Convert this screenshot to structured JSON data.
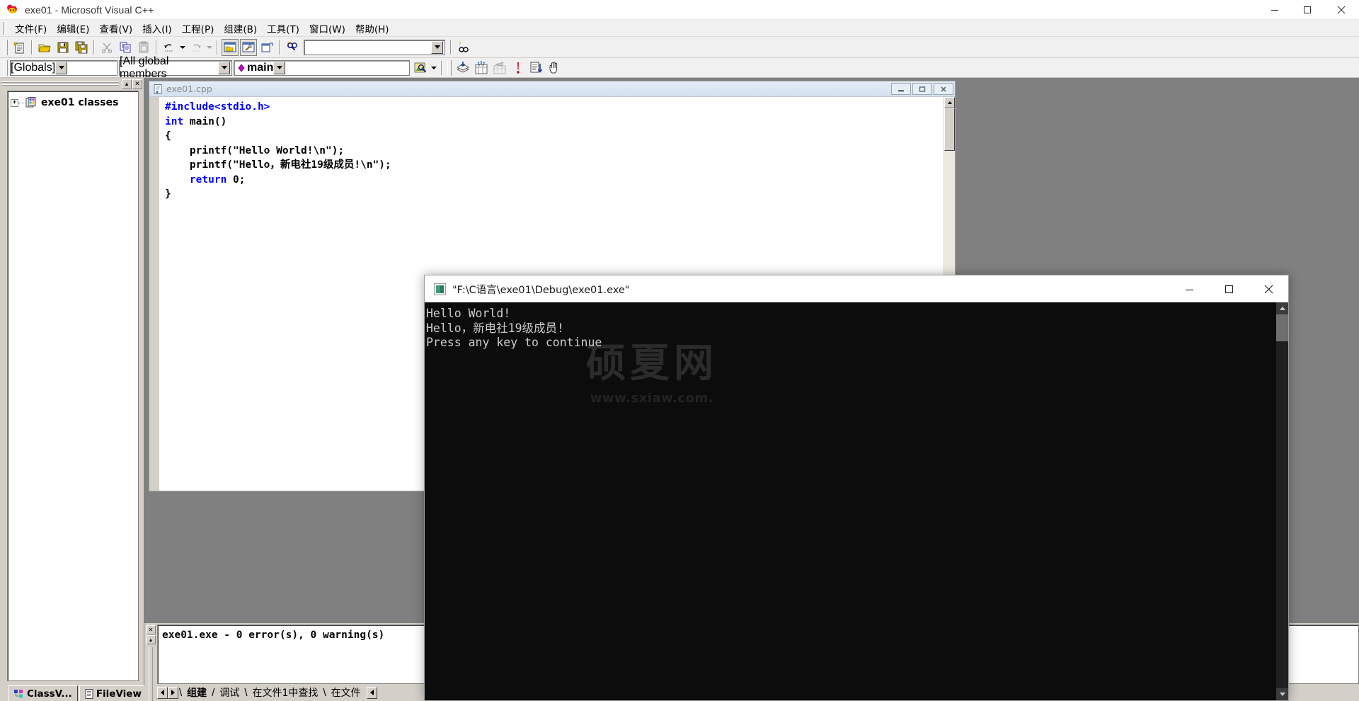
{
  "app": {
    "title": "exe01 - Microsoft Visual C++",
    "icon": "vcpp-logo-icon",
    "window_buttons": [
      {
        "name": "minimize",
        "glyph": "—"
      },
      {
        "name": "maximize",
        "glyph": "❐"
      },
      {
        "name": "close",
        "glyph": "✕"
      }
    ]
  },
  "menubar": {
    "items": [
      {
        "label": "文件(F)",
        "name": "menu-file"
      },
      {
        "label": "编辑(E)",
        "name": "menu-edit"
      },
      {
        "label": "查看(V)",
        "name": "menu-view"
      },
      {
        "label": "插入(I)",
        "name": "menu-insert"
      },
      {
        "label": "工程(P)",
        "name": "menu-project"
      },
      {
        "label": "组建(B)",
        "name": "menu-build"
      },
      {
        "label": "工具(T)",
        "name": "menu-tools"
      },
      {
        "label": "窗口(W)",
        "name": "menu-window"
      },
      {
        "label": "帮助(H)",
        "name": "menu-help"
      }
    ]
  },
  "toolbar": {
    "find_combo_value": "",
    "find_combo_placeholder": ""
  },
  "wizardbar": {
    "class_combo": "[Globals]",
    "members_combo": "[All global members",
    "function_combo": "main"
  },
  "workspace": {
    "tree": {
      "expander": "+",
      "root_label": "exe01 classes",
      "root_icon": "classes-folder-icon"
    },
    "tabs": [
      {
        "label": "ClassV...",
        "name": "tab-classview",
        "icon": "classview-icon",
        "active": true
      },
      {
        "label": "FileView",
        "name": "tab-fileview",
        "icon": "fileview-icon",
        "active": false
      }
    ],
    "buttons": [
      {
        "name": "ws-float-button",
        "glyph": "▴"
      },
      {
        "name": "ws-close-button",
        "glyph": "✕"
      }
    ]
  },
  "editor": {
    "tab_title": "exe01.cpp",
    "tab_icon": "cpp-file-icon",
    "mdi_buttons": [
      {
        "name": "mdi-minimize",
        "glyph": "–"
      },
      {
        "name": "mdi-restore",
        "glyph": "□"
      },
      {
        "name": "mdi-close",
        "glyph": "✕"
      }
    ],
    "code_lines": [
      {
        "tokens": [
          {
            "t": "#include<stdio.h>",
            "c": "kw"
          }
        ]
      },
      {
        "tokens": [
          {
            "t": "int",
            "c": "kw"
          },
          {
            "t": " main()",
            "c": "plain"
          }
        ]
      },
      {
        "tokens": [
          {
            "t": "{",
            "c": "plain"
          }
        ]
      },
      {
        "tokens": [
          {
            "t": "    printf(\"Hello World!\\n\");",
            "c": "plain"
          }
        ]
      },
      {
        "tokens": [
          {
            "t": "    printf(\"Hello，新电社19级成员!\\n\");",
            "c": "plain"
          }
        ]
      },
      {
        "tokens": [
          {
            "t": "    ",
            "c": "plain"
          },
          {
            "t": "return",
            "c": "kw"
          },
          {
            "t": " 0;",
            "c": "plain"
          }
        ]
      },
      {
        "tokens": [
          {
            "t": "}",
            "c": "plain"
          }
        ]
      }
    ]
  },
  "output": {
    "text": "exe01.exe - 0 error(s), 0 warning(s)",
    "tabs": [
      {
        "label": "组建",
        "name": "output-tab-build",
        "active": true
      },
      {
        "label": "调试",
        "name": "output-tab-debug",
        "active": false
      },
      {
        "label": "在文件1中查找",
        "name": "output-tab-find1",
        "active": false
      },
      {
        "label": "在文件",
        "name": "output-tab-find2",
        "active": false
      }
    ],
    "buttons": [
      {
        "name": "output-close-button",
        "glyph": "✕"
      },
      {
        "name": "output-scrollup-button",
        "glyph": "▴"
      }
    ]
  },
  "console": {
    "title": "\"F:\\C语言\\exe01\\Debug\\exe01.exe\"",
    "icon": "console-icon",
    "lines": [
      "Hello World!",
      "Hello，新电社19级成员!",
      "Press any key to continue"
    ],
    "window_buttons": [
      {
        "name": "console-minimize",
        "glyph": "—"
      },
      {
        "name": "console-maximize",
        "glyph": "☐"
      },
      {
        "name": "console-close",
        "glyph": "✕"
      }
    ],
    "watermark": {
      "main": "硕夏网",
      "sub": "www.sxiaw.com."
    }
  },
  "colors": {
    "chrome": "#d4d0c8",
    "keyword_blue": "#0000ff",
    "console_bg": "#0c0c0c",
    "console_fg": "#cccccc",
    "mdi_backdrop": "#808080"
  }
}
